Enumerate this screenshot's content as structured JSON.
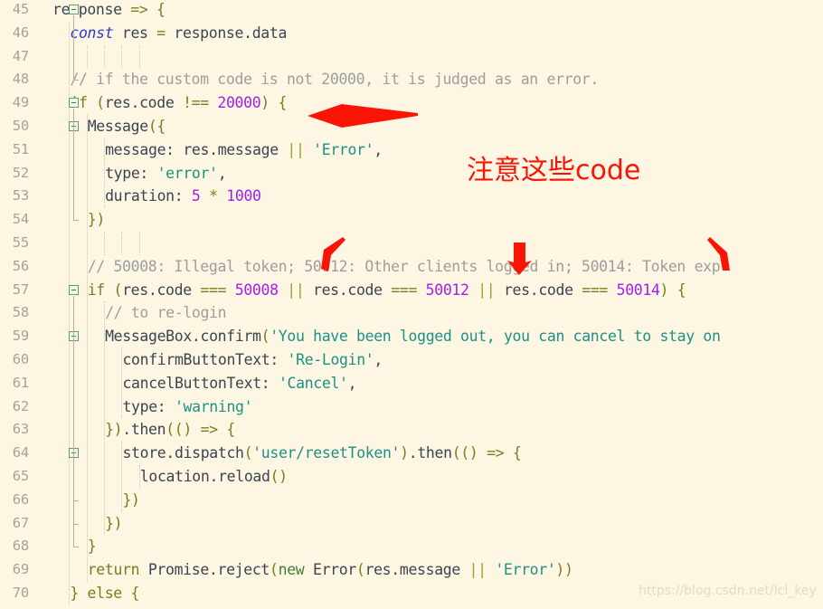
{
  "editor": {
    "background": "#fdf6e3",
    "text_color": "#3b4450",
    "gutter_color": "#a8a296",
    "first_line_number": 45,
    "last_line_number": 70,
    "lines": [
      {
        "num": "45",
        "indent": 0,
        "fold": true,
        "text": "response => {"
      },
      {
        "num": "46",
        "indent": 1,
        "fold": false,
        "text": "const res = response.data"
      },
      {
        "num": "47",
        "indent": 0,
        "fold": false,
        "text": ""
      },
      {
        "num": "48",
        "indent": 1,
        "fold": false,
        "text": "// if the custom code is not 20000, it is judged as an error."
      },
      {
        "num": "49",
        "indent": 1,
        "fold": true,
        "text": "if (res.code !== 20000) {"
      },
      {
        "num": "50",
        "indent": 2,
        "fold": true,
        "text": "Message({"
      },
      {
        "num": "51",
        "indent": 3,
        "fold": false,
        "text": "message: res.message || 'Error',"
      },
      {
        "num": "52",
        "indent": 3,
        "fold": false,
        "text": "type: 'error',"
      },
      {
        "num": "53",
        "indent": 3,
        "fold": false,
        "text": "duration: 5 * 1000"
      },
      {
        "num": "54",
        "indent": 2,
        "fold": false,
        "text": "})"
      },
      {
        "num": "55",
        "indent": 0,
        "fold": false,
        "text": ""
      },
      {
        "num": "56",
        "indent": 2,
        "fold": false,
        "text": "// 50008: Illegal token; 50012: Other clients logged in; 50014: Token exp"
      },
      {
        "num": "57",
        "indent": 2,
        "fold": true,
        "text": "if (res.code === 50008 || res.code === 50012 || res.code === 50014) {"
      },
      {
        "num": "58",
        "indent": 3,
        "fold": false,
        "text": "// to re-login"
      },
      {
        "num": "59",
        "indent": 3,
        "fold": true,
        "text": "MessageBox.confirm('You have been logged out, you can cancel to stay on"
      },
      {
        "num": "60",
        "indent": 4,
        "fold": false,
        "text": "confirmButtonText: 'Re-Login',"
      },
      {
        "num": "61",
        "indent": 4,
        "fold": false,
        "text": "cancelButtonText: 'Cancel',"
      },
      {
        "num": "62",
        "indent": 4,
        "fold": false,
        "text": "type: 'warning'"
      },
      {
        "num": "63",
        "indent": 3,
        "fold": false,
        "text": "}).then(() => {"
      },
      {
        "num": "64",
        "indent": 4,
        "fold": true,
        "text": "store.dispatch('user/resetToken').then(() => {"
      },
      {
        "num": "65",
        "indent": 5,
        "fold": false,
        "text": "location.reload()"
      },
      {
        "num": "66",
        "indent": 4,
        "fold": false,
        "text": "})"
      },
      {
        "num": "67",
        "indent": 3,
        "fold": false,
        "text": "})"
      },
      {
        "num": "68",
        "indent": 2,
        "fold": false,
        "text": "}"
      },
      {
        "num": "69",
        "indent": 2,
        "fold": false,
        "text": "return Promise.reject(new Error(res.message || 'Error'))"
      },
      {
        "num": "70",
        "indent": 1,
        "fold": false,
        "text": "} else {"
      }
    ],
    "syntax_colors": {
      "keyword": "#7a7d1e",
      "declaration": "#2a3ec9",
      "number": "#a020f0",
      "string": "#1d9186",
      "comment": "#9d9d9d",
      "operator": "#9ca02a"
    }
  },
  "annotations": {
    "color": "#fa1405",
    "note_text": "注意这些code",
    "arrows": [
      {
        "name": "arrow-to-20000",
        "type": "horizontal-left"
      },
      {
        "name": "arrow-to-50008",
        "type": "diagonal-down-left"
      },
      {
        "name": "arrow-to-50012",
        "type": "vertical-down"
      },
      {
        "name": "arrow-to-50014",
        "type": "diagonal-down-right"
      }
    ]
  },
  "watermark": {
    "text": "https://blog.csdn.net/lcl_key",
    "color": "#e2dcc4"
  }
}
